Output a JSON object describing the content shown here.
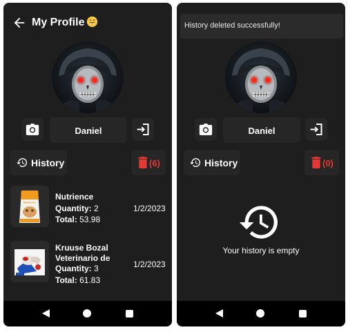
{
  "left_screen": {
    "title": "My Profile",
    "title_emoji": "grinning-face-emoji",
    "username": "Daniel",
    "history_label": "History",
    "delete_count": "(6)",
    "items": [
      {
        "name": "Nutrience",
        "quantity_label": "Quantity:",
        "quantity": "2",
        "total_label": "Total:",
        "total": "53.98",
        "date": "1/2/2023",
        "image_label": "Nutrience"
      },
      {
        "name": "Kruuse Bozal Veterinario de",
        "quantity_label": "Quantity:",
        "quantity": "3",
        "total_label": "Total:",
        "total": "61.83",
        "date": "1/2/2023"
      }
    ]
  },
  "right_screen": {
    "snackbar_message": "History deleted successfully!",
    "username": "Daniel",
    "history_label": "History",
    "delete_count": "(0)",
    "empty_message": "Your history is empty"
  },
  "colors": {
    "background": "#1e1e1e",
    "card": "#262626",
    "delete_red": "#e53935",
    "navbar": "#000000"
  },
  "icons": [
    "arrow-left-icon",
    "camera-icon",
    "logout-icon",
    "history-icon",
    "trash-icon",
    "nav-back-icon",
    "nav-home-icon",
    "nav-recent-icon"
  ]
}
